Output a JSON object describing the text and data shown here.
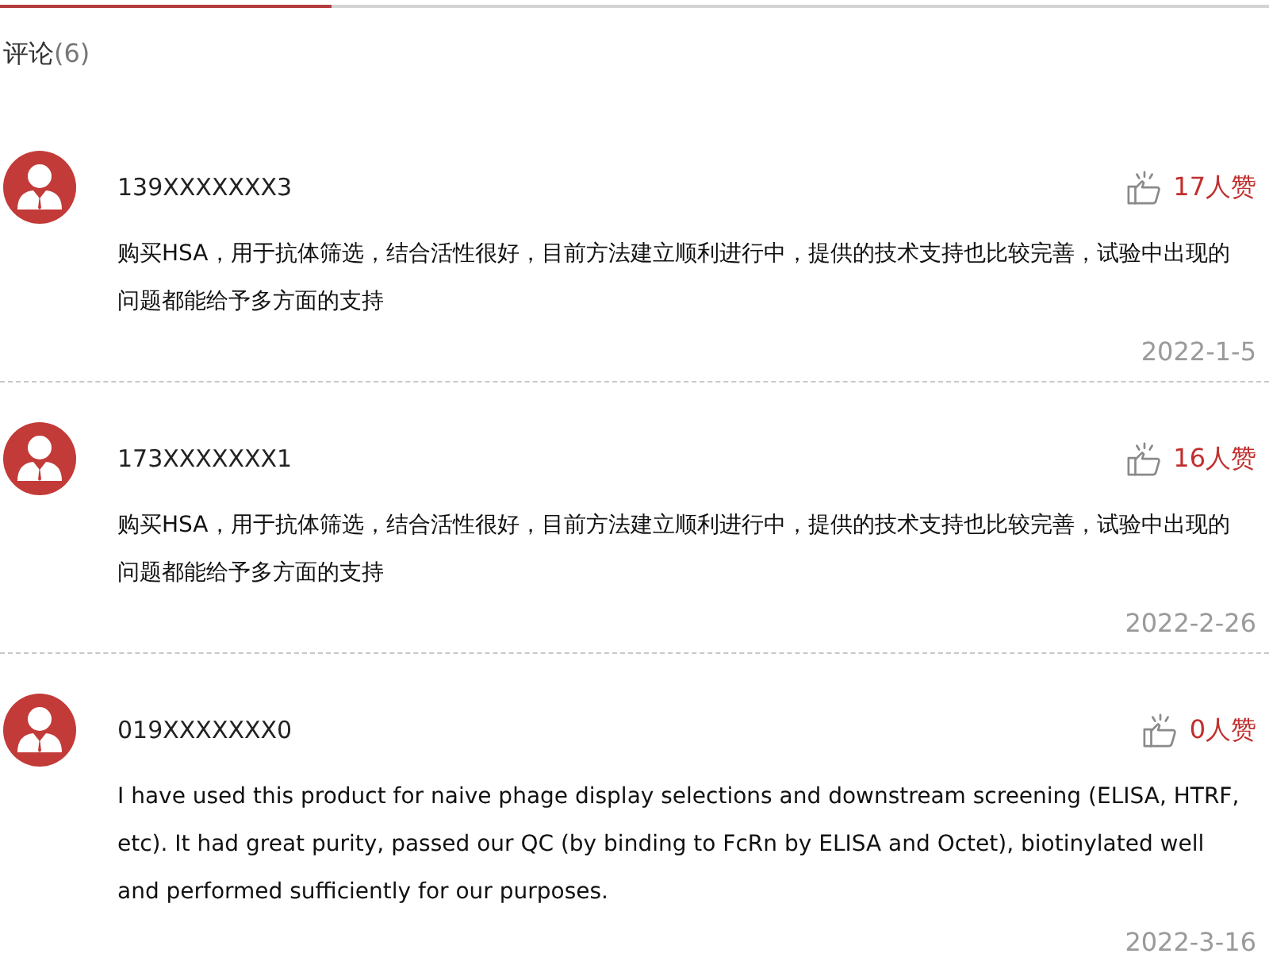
{
  "comments_header": {
    "title": "评论",
    "count": "(6)"
  },
  "comments": [
    {
      "user": "139XXXXXXX3",
      "likes": "17人赞",
      "text": "购买HSA，用于抗体筛选，结合活性很好，目前方法建立顺利进行中，提供的技术支持也比较完善，试验中出现的问题都能给予多方面的支持",
      "date": "2022-1-5"
    },
    {
      "user": "173XXXXXXX1",
      "likes": "16人赞",
      "text": "购买HSA，用于抗体筛选，结合活性很好，目前方法建立顺利进行中，提供的技术支持也比较完善，试验中出现的问题都能给予多方面的支持",
      "date": "2022-2-26"
    },
    {
      "user": "019XXXXXXX0",
      "likes": "0人赞",
      "text": "I have used this product for naive phage display selections and downstream screening (ELISA, HTRF, etc). It had great purity, passed our QC (by binding to FcRn by ELISA and Octet), biotinylated well and performed sufficiently for our purposes.",
      "date": "2022-3-16"
    }
  ]
}
